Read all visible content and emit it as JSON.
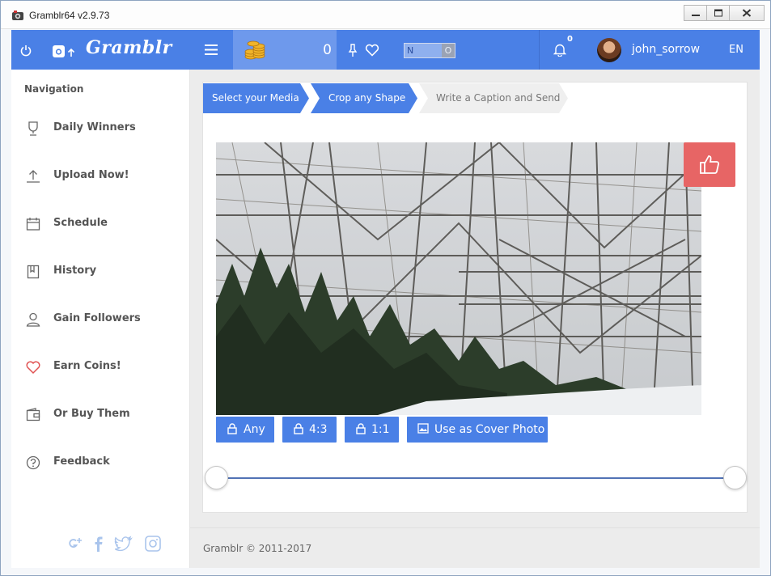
{
  "window": {
    "title": "Gramblr64 v2.9.73"
  },
  "topbar": {
    "logo": "Gramblr",
    "coins": "0",
    "toggle_left": "N",
    "toggle_right": "O",
    "notifications": "0",
    "username": "john_sorrow",
    "language": "EN",
    "accent": "#4a80e6"
  },
  "sidebar": {
    "title": "Navigation",
    "items": [
      {
        "label": "Daily Winners",
        "icon": "trophy-icon"
      },
      {
        "label": "Upload Now!",
        "icon": "upload-icon"
      },
      {
        "label": "Schedule",
        "icon": "calendar-icon"
      },
      {
        "label": "History",
        "icon": "bookmark-icon"
      },
      {
        "label": "Gain Followers",
        "icon": "user-icon"
      },
      {
        "label": "Earn Coins!",
        "icon": "heart-icon"
      },
      {
        "label": "Or Buy Them",
        "icon": "wallet-icon"
      },
      {
        "label": "Feedback",
        "icon": "question-icon"
      }
    ],
    "socials": [
      "google-plus-icon",
      "facebook-icon",
      "twitter-icon",
      "instagram-icon"
    ]
  },
  "steps": [
    {
      "label": "Select your Media",
      "state": "active"
    },
    {
      "label": "Crop any Shape",
      "state": "active"
    },
    {
      "label": "Write a Caption and Send",
      "state": "inactive"
    }
  ],
  "crop": {
    "buttons": [
      {
        "label": "Any",
        "icon": "lock-icon"
      },
      {
        "label": "4:3",
        "icon": "lock-icon"
      },
      {
        "label": "1:1",
        "icon": "lock-icon"
      },
      {
        "label": "Use as Cover Photo",
        "icon": "image-icon"
      }
    ],
    "like_color": "#e76565"
  },
  "footer": {
    "copyright": "Gramblr © 2011-2017"
  }
}
